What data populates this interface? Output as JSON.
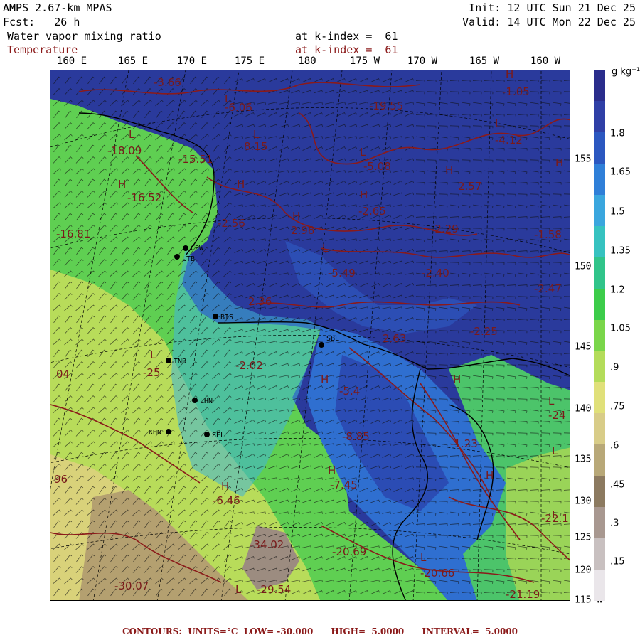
{
  "header": {
    "model": "AMPS 2.67-km MPAS",
    "fcst_label": "Fcst:",
    "fcst_value": "26 h",
    "init": "Init: 12 UTC Sun 21 Dec 25",
    "valid": "Valid: 14 UTC Mon 22 Dec 25",
    "field1": "Water vapor mixing ratio",
    "field1_level": "at k-index =  61",
    "field2": "Temperature",
    "field2_level": "at k-index =  61"
  },
  "lon_labels": [
    "160 E",
    "165 E",
    "170 E",
    "175 E",
    "180",
    "175 W",
    "170 W",
    "165 W",
    "160 W"
  ],
  "lat_labels": [
    "155 W",
    "150 W",
    "145 W",
    "140 W",
    "135 W",
    "130 W",
    "125 W",
    "120 W",
    "115 W"
  ],
  "colorbar": {
    "unit": "g kg⁻¹",
    "labels": [
      "1.8",
      "1.65",
      "1.5",
      "1.35",
      "1.2",
      "1.05",
      ".9",
      ".75",
      ".6",
      ".45",
      ".3",
      ".15"
    ],
    "colors": [
      "#2a2d8c",
      "#2f3fa6",
      "#2b57c0",
      "#2f7fd8",
      "#3aa6de",
      "#36c2c0",
      "#30c48a",
      "#3ccc4a",
      "#7ad64a",
      "#b4dc5a",
      "#e0e07a",
      "#d8cc88",
      "#b8a878",
      "#8c7a60",
      "#a89890",
      "#c8c0c0",
      "#eae6ea"
    ]
  },
  "stations": [
    "CPW",
    "LTB",
    "BIS",
    "SBL",
    "TNB",
    "LHN",
    "SEL",
    "KHN"
  ],
  "contour_labels": [
    "-3.66",
    "-6.06",
    "8.15",
    "-19.55",
    "-1.05",
    "-4.12",
    "-5.08",
    "2.57",
    "-2.65",
    "-2.56",
    "2.98",
    "-2.29",
    "-1.58",
    "-5.49",
    "-2.40",
    "-2.47",
    "2.36",
    "2.63",
    "-2.25",
    "-2.02",
    "-5.4",
    "-8.85",
    "-7.45",
    "-1.23",
    "-6.46",
    "-34.02",
    "-29.54",
    "-30.07",
    "-20.69",
    "-20.66",
    "-21.19",
    "-18.09",
    "-15.51",
    "-16.52",
    "-16.81",
    "-25",
    "-24",
    "-22.1",
    "96",
    "04"
  ],
  "map_letters": [
    "H",
    "L"
  ],
  "footer": {
    "contours": "CONTOURS:",
    "units": "UNITS=°C",
    "low": "LOW= -30.000",
    "high": "HIGH=  5.0000",
    "interval": "INTERVAL=  5.0000"
  }
}
